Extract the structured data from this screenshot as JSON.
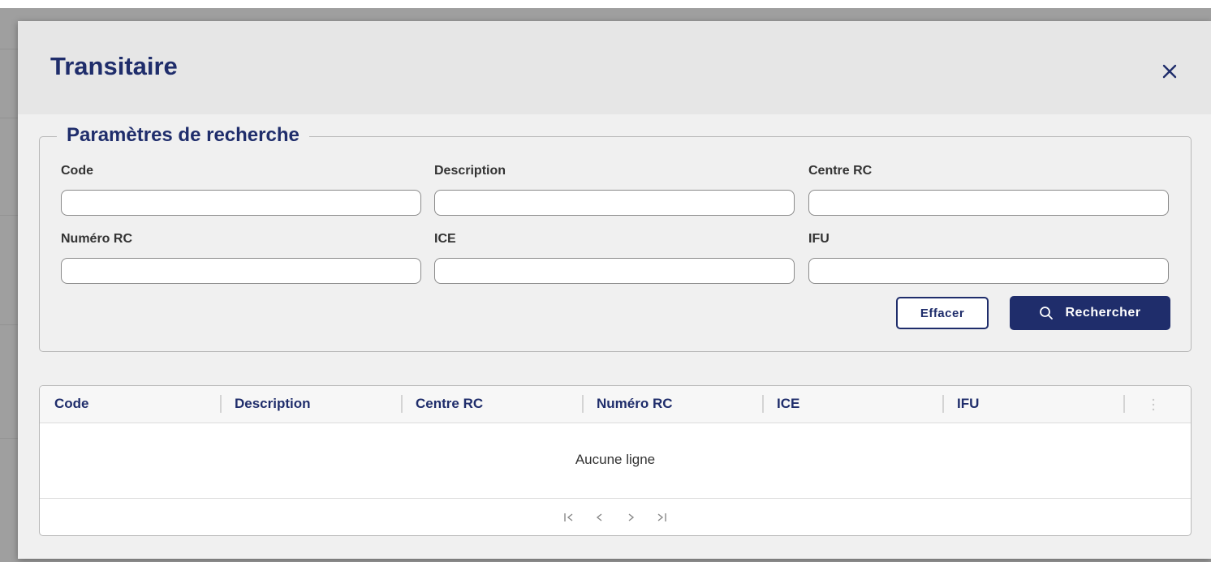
{
  "modal": {
    "title": "Transitaire",
    "close_icon": "close-icon"
  },
  "search": {
    "legend": "Paramètres de recherche",
    "fields": {
      "code": {
        "label": "Code",
        "value": ""
      },
      "description": {
        "label": "Description",
        "value": ""
      },
      "centre_rc": {
        "label": "Centre RC",
        "value": ""
      },
      "numero_rc": {
        "label": "Numéro RC",
        "value": ""
      },
      "ice": {
        "label": "ICE",
        "value": ""
      },
      "ifu": {
        "label": "IFU",
        "value": ""
      }
    },
    "clear_label": "Effacer",
    "search_label": "Rechercher",
    "search_icon": "search-icon"
  },
  "grid": {
    "columns": [
      "Code",
      "Description",
      "Centre RC",
      "Numéro RC",
      "ICE",
      "IFU"
    ],
    "empty_message": "Aucune ligne",
    "pager_icons": [
      "first-page-icon",
      "prev-page-icon",
      "next-page-icon",
      "last-page-icon"
    ]
  },
  "colors": {
    "primary": "#1f2d6b",
    "modal_bg": "#f0f0f0",
    "header_bg": "#e6e6e6"
  }
}
